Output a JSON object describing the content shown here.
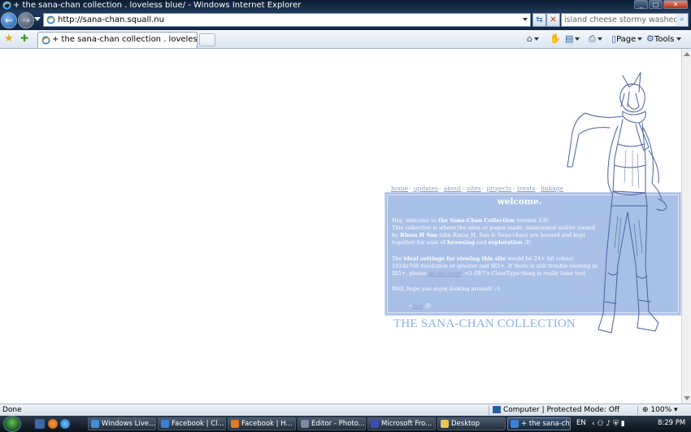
{
  "window": {
    "title": "+ the sana-chan collection . loveless blue/ - Windows Internet Explorer",
    "controls": [
      "minimize",
      "maximize",
      "close"
    ]
  },
  "address_bar": {
    "url": "http://sana-chan.squall.nu",
    "refresh_icon": "refresh-icon",
    "stop_icon": "stop-icon"
  },
  "search": {
    "text": "island cheese stormy washed rind>"
  },
  "tabs": [
    {
      "label": "+ the sana-chan collection . loveless blue/"
    }
  ],
  "command_bar": {
    "home_icon": "home-icon",
    "feeds_icon": "feeds-icon",
    "print_icon": "print-icon",
    "page_label": "Page",
    "tools_label": "Tools"
  },
  "site": {
    "nav": [
      "home",
      "updates",
      "about",
      "sites",
      "projects",
      "treats",
      "linkage"
    ],
    "nav_separator": "·",
    "welcome_heading": "welcome.",
    "p1": {
      "a": "Hey, welcome to ",
      "b": "the Sana-Chan Collection",
      "c": " version 3.0!",
      "d": "This collective is where the sites or pages made, maintained and/or owned by ",
      "e": "Rinoa H San",
      "f": " (aka Rinoa_H, San & Sana-chan) are housed and kept together for ease of ",
      "g": "browsing",
      "h": " and ",
      "i": "exploration",
      "j": " :D"
    },
    "p2": {
      "a": "The ",
      "b": "ideal settings for viewing this site",
      "c": " would be 24+ bit colour, 1024x768 resolution or greater and IE5+. If there is still trouble viewing in IE5+, please ",
      "link": "let me know",
      "d": ". <3 (IE7's ClearType thing is really lame too)"
    },
    "p3": "Well, hope you enjoy looking around! :3",
    "signature": {
      "prefix": "~",
      "link": "San",
      "suffix": " :D"
    },
    "collection_title": "THE SANA-CHAN COLLECTION"
  },
  "status_bar": {
    "status": "Done",
    "zone": "Computer | Protected Mode: Off",
    "zoom": "100%"
  },
  "taskbar": {
    "items": [
      {
        "label": "Windows Live...",
        "color": "#3f8fd8"
      },
      {
        "label": "Facebook | Cl...",
        "color": "#3a7fd5"
      },
      {
        "label": "Facebook | H...",
        "color": "#e07a1b"
      },
      {
        "label": "Editor - Photo...",
        "color": "#7a8aa0"
      },
      {
        "label": "Microsoft Fro...",
        "color": "#3b4fb0"
      },
      {
        "label": "Desktop",
        "color": "#e8c35a"
      },
      {
        "label": "+ the sana-ch...",
        "color": "#3a7fd5"
      }
    ],
    "language": "EN",
    "time": "8:29 PM"
  },
  "colors": {
    "panel_bg": "#a9c0e6",
    "accent_text": "#8fb0e0",
    "nav_link": "#8a9ec8"
  }
}
